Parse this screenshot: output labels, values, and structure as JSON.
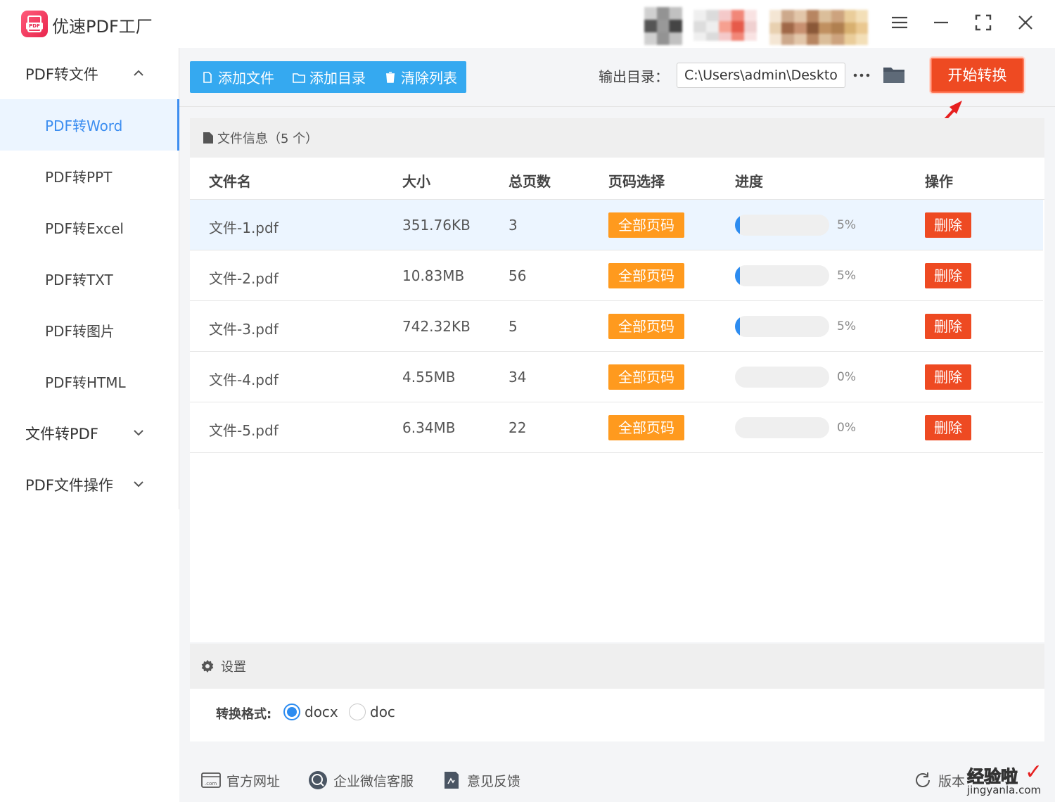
{
  "app": {
    "title": "优速PDF工厂",
    "logo_text": "PDF"
  },
  "window_controls": {
    "menu_icon": "menu-icon",
    "minimize_icon": "minimize-icon",
    "maximize_icon": "maximize-icon",
    "close_icon": "close-icon"
  },
  "sidebar": {
    "groups": [
      {
        "label": "PDF转文件",
        "expanded": true
      },
      {
        "label": "文件转PDF",
        "expanded": false
      },
      {
        "label": "PDF文件操作",
        "expanded": false
      }
    ],
    "items": [
      {
        "label": "PDF转Word",
        "active": true
      },
      {
        "label": "PDF转PPT",
        "active": false
      },
      {
        "label": "PDF转Excel",
        "active": false
      },
      {
        "label": "PDF转TXT",
        "active": false
      },
      {
        "label": "PDF转图片",
        "active": false
      },
      {
        "label": "PDF转HTML",
        "active": false
      }
    ]
  },
  "toolbar": {
    "add_file": "添加文件",
    "add_dir": "添加目录",
    "clear_list": "清除列表",
    "output_label": "输出目录：",
    "output_path": "C:\\Users\\admin\\Deskto",
    "start": "开始转换"
  },
  "file_panel": {
    "title": "文件信息（5 个）",
    "columns": [
      "文件名",
      "大小",
      "总页数",
      "页码选择",
      "进度",
      "操作"
    ],
    "rows": [
      {
        "name": "文件-1.pdf",
        "size": "351.76KB",
        "pages": "3",
        "page_select": "全部页码",
        "progress": 5,
        "progress_text": "5%",
        "action": "删除",
        "highlighted": true
      },
      {
        "name": "文件-2.pdf",
        "size": "10.83MB",
        "pages": "56",
        "page_select": "全部页码",
        "progress": 5,
        "progress_text": "5%",
        "action": "删除",
        "highlighted": false
      },
      {
        "name": "文件-3.pdf",
        "size": "742.32KB",
        "pages": "5",
        "page_select": "全部页码",
        "progress": 5,
        "progress_text": "5%",
        "action": "删除",
        "highlighted": false
      },
      {
        "name": "文件-4.pdf",
        "size": "4.55MB",
        "pages": "34",
        "page_select": "全部页码",
        "progress": 0,
        "progress_text": "0%",
        "action": "删除",
        "highlighted": false
      },
      {
        "name": "文件-5.pdf",
        "size": "6.34MB",
        "pages": "22",
        "page_select": "全部页码",
        "progress": 0,
        "progress_text": "0%",
        "action": "删除",
        "highlighted": false
      }
    ]
  },
  "settings": {
    "title": "设置",
    "format_label": "转换格式:",
    "options": [
      {
        "label": "docx",
        "selected": true
      },
      {
        "label": "doc",
        "selected": false
      }
    ]
  },
  "footer": {
    "website": "官方网址",
    "wechat": "企业微信客服",
    "feedback": "意见反馈",
    "version": "版本"
  },
  "watermark": {
    "top": "经验啦",
    "bottom": "jingyanla.com"
  },
  "colors": {
    "accent_blue": "#35a9f0",
    "primary": "#2d8cf0",
    "start_red": "#ee4a22",
    "tag_orange": "#ff9a1e"
  }
}
